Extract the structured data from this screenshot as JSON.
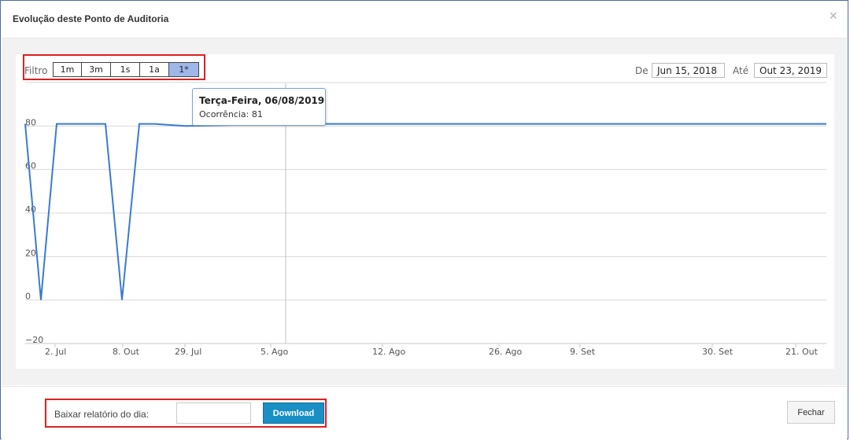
{
  "dialog": {
    "title": "Evolução deste Ponto de Auditoria",
    "close_icon": "×"
  },
  "filter": {
    "label": "Filtro",
    "buttons": [
      "1m",
      "3m",
      "1s",
      "1a",
      "1*"
    ],
    "active_index": 4
  },
  "date_range": {
    "from_label": "De",
    "from_value": "Jun 15, 2018",
    "to_label": "Até",
    "to_value": "Out 23, 2019"
  },
  "tooltip": {
    "title": "Terça-Feira, 06/08/2019",
    "line": "Ocorrência: 81"
  },
  "chart_data": {
    "type": "line",
    "y_ticks": [
      "80",
      "60",
      "40",
      "20",
      "0",
      "−20"
    ],
    "ylim": [
      -20,
      100
    ],
    "x_ticks": [
      "2. Jul",
      "8. Out",
      "29. Jul",
      "5. Ago",
      "12. Ago",
      "26. Ago",
      "9. Set",
      "30. Set",
      "21. Out"
    ],
    "line_color": "#3a7ad4",
    "series": [
      {
        "values": [
          81,
          0,
          81,
          81,
          81,
          0,
          81,
          81,
          80.5,
          80,
          81,
          81,
          81,
          81,
          81,
          81,
          81
        ]
      }
    ],
    "highlight": {
      "date": "06/08/2019",
      "value": 81
    },
    "grid": true
  },
  "footer": {
    "report_label": "Baixar relatório do dia:",
    "report_value": "",
    "download_label": "Download",
    "close_label": "Fechar"
  }
}
